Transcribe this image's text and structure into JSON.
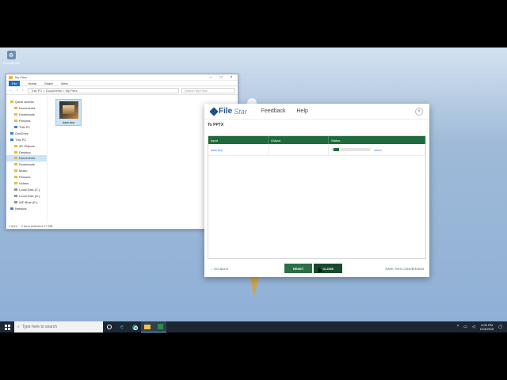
{
  "desktop": {
    "icon_label": "Recycle Bin"
  },
  "explorer": {
    "title": "My Files",
    "ribbon": [
      "File",
      "Home",
      "Share",
      "View"
    ],
    "path": "This PC  >  Documents  >  My Files",
    "search_placeholder": "Search My Files",
    "nav": [
      {
        "label": "Quick access",
        "level": 1
      },
      {
        "label": "Documents",
        "level": 2
      },
      {
        "label": "Downloads",
        "level": 2
      },
      {
        "label": "Pictures",
        "level": 2
      },
      {
        "label": "This PC",
        "level": 2
      },
      {
        "label": "OneDrive",
        "level": 1
      },
      {
        "label": "This PC",
        "level": 1
      },
      {
        "label": "3D Objects",
        "level": 2
      },
      {
        "label": "Desktop",
        "level": 2
      },
      {
        "label": "Documents",
        "level": 2,
        "selected": true
      },
      {
        "label": "Downloads",
        "level": 2
      },
      {
        "label": "Music",
        "level": 2
      },
      {
        "label": "Pictures",
        "level": 2
      },
      {
        "label": "Videos",
        "level": 2
      },
      {
        "label": "Local Disk (C:)",
        "level": 2
      },
      {
        "label": "Local Disk (D:)",
        "level": 2
      },
      {
        "label": "WD Blue (E:)",
        "level": 2
      },
      {
        "label": "Network",
        "level": 1
      }
    ],
    "file_name": "data.key",
    "status_items": "1 item",
    "status_selected": "1 item selected  27 MB"
  },
  "dialog": {
    "brand_main": "File",
    "brand_sub": "Star",
    "nav": [
      "Feedback",
      "Help"
    ],
    "close_glyph": "×",
    "subtitle": "To PPTX",
    "columns": [
      "Input",
      "Output",
      "Status"
    ],
    "rows": [
      {
        "input": "data.key",
        "output": "",
        "progress": 0.18,
        "action": "Abort"
      }
    ],
    "go_back": "GO BACK",
    "reset": "RESET",
    "close": "CLOSE",
    "rate": "RATE THIS CONVERSION"
  },
  "taskbar": {
    "search_placeholder": "Type here to search",
    "time": "4:00 PM",
    "date": "11/3/2019"
  }
}
